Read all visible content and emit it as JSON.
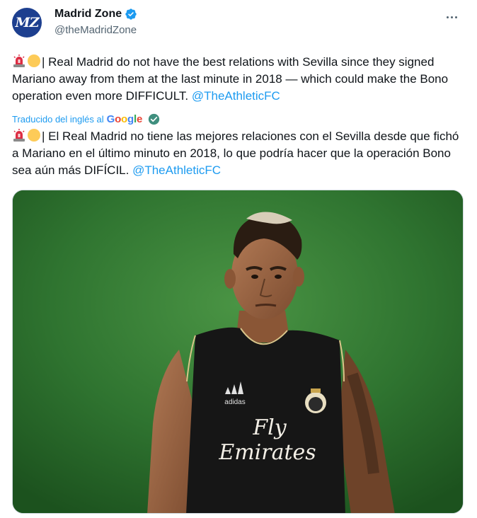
{
  "author": {
    "avatar_text": "MZ",
    "display_name": "Madrid Zone",
    "handle": "@theMadridZone",
    "verified_color": "#1d9bf0"
  },
  "tweet": {
    "original_text": "| Real Madrid do not have the best relations with Sevilla since they signed Mariano away from them at the last minute in 2018 — which could make the Bono operation even more DIFFICULT.",
    "original_mention": "@TheAthleticFC",
    "translation_label": "Traducido del inglés al",
    "translation_provider": "Google",
    "translated_text": "| El Real Madrid no tiene las mejores relaciones con el Sevilla desde que fichó a Mariano en el último minuto en 2018, lo que podría hacer que la operación Bono sea aún más DIFÍCIL.",
    "translated_mention": "@TheAthleticFC",
    "emojis": [
      "police-light-icon",
      "yellow-circle-icon"
    ]
  },
  "media": {
    "shirt_line1": "Fly",
    "shirt_line2": "Emirates",
    "brand": "adidas"
  },
  "colors": {
    "link": "#1d9bf0",
    "text": "#0f1419",
    "secondary": "#536471"
  }
}
